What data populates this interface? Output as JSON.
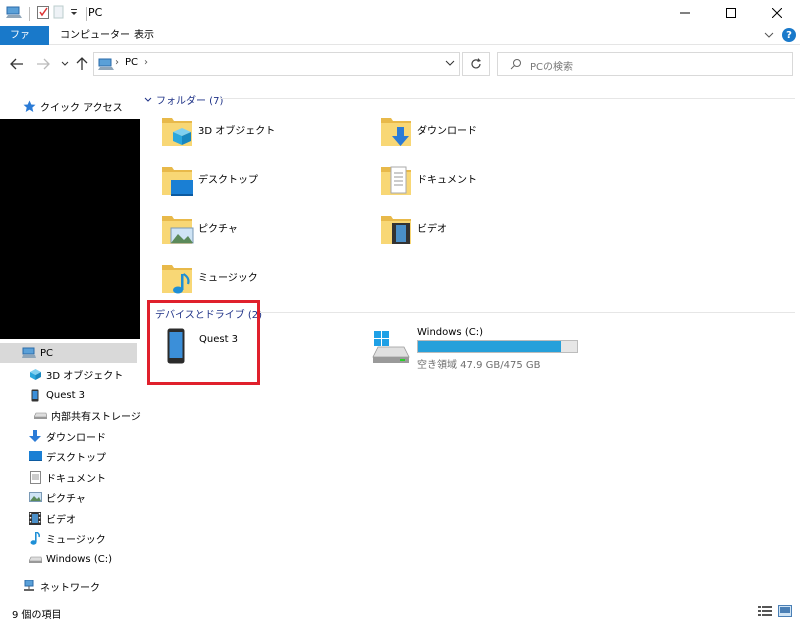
{
  "window": {
    "title": "PC"
  },
  "ribbon": {
    "tabs": [
      {
        "label": "ファイル",
        "active": true
      },
      {
        "label": "コンピューター",
        "active": false
      },
      {
        "label": "表示",
        "active": false
      }
    ],
    "help": "?"
  },
  "address": {
    "crumb": "PC",
    "separator": "›",
    "search_placeholder": "PCの検索"
  },
  "nav_pane": {
    "quick_access": "クイック アクセス",
    "items": [
      {
        "label": "PC",
        "icon": "pc-icon",
        "selected": true
      },
      {
        "label": "3D オブジェクト",
        "icon": "3d-objects-icon"
      },
      {
        "label": "Quest 3",
        "icon": "phone-icon"
      },
      {
        "label": "内部共有ストレージ",
        "icon": "storage-icon"
      },
      {
        "label": "ダウンロード",
        "icon": "download-icon"
      },
      {
        "label": "デスクトップ",
        "icon": "desktop-icon"
      },
      {
        "label": "ドキュメント",
        "icon": "documents-icon"
      },
      {
        "label": "ピクチャ",
        "icon": "pictures-icon"
      },
      {
        "label": "ビデオ",
        "icon": "videos-icon"
      },
      {
        "label": "ミュージック",
        "icon": "music-icon"
      },
      {
        "label": "Windows (C:)",
        "icon": "drive-icon"
      }
    ],
    "network": "ネットワーク"
  },
  "content": {
    "folders_header": "フォルダー (7)",
    "folders": [
      {
        "label": "3D オブジェクト",
        "icon": "3d-objects-icon"
      },
      {
        "label": "ダウンロード",
        "icon": "download-icon"
      },
      {
        "label": "デスクトップ",
        "icon": "desktop-icon"
      },
      {
        "label": "ドキュメント",
        "icon": "documents-icon"
      },
      {
        "label": "ピクチャ",
        "icon": "pictures-icon"
      },
      {
        "label": "ビデオ",
        "icon": "videos-icon"
      },
      {
        "label": "ミュージック",
        "icon": "music-icon"
      }
    ],
    "devices_header": "デバイスとドライブ (2)",
    "devices": [
      {
        "label": "Quest 3",
        "icon": "phone-icon"
      },
      {
        "label": "Windows (C:)",
        "icon": "drive-icon",
        "free_text": "空き領域 47.9 GB/475 GB",
        "used_fraction": 0.9
      }
    ]
  },
  "status": {
    "item_count": "9 個の項目"
  },
  "colors": {
    "accent": "#1979ca",
    "folder": "#f8d775",
    "drive_fill": "#26a0da",
    "highlight": "#e0202c"
  }
}
